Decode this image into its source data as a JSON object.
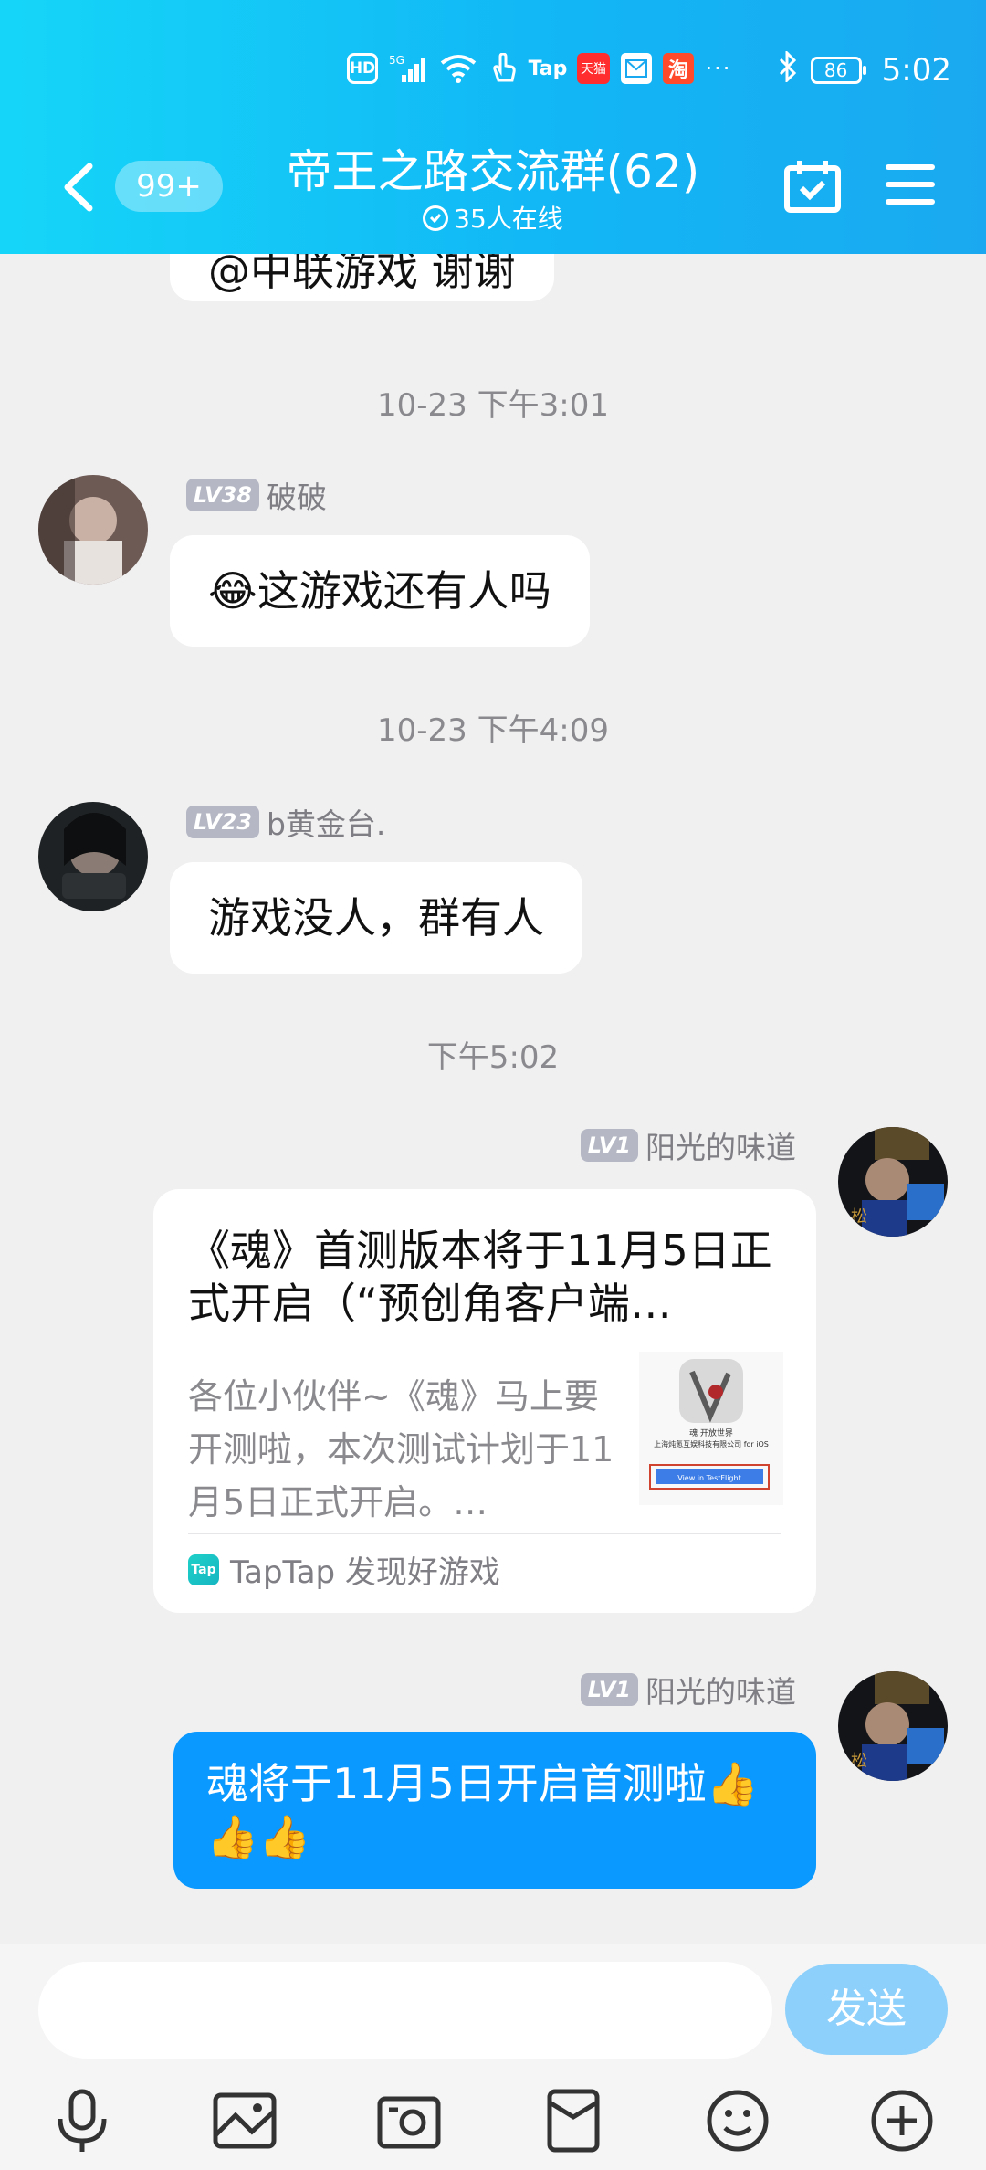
{
  "status_bar": {
    "hd": "HD",
    "network": "5G",
    "tap": "Tap",
    "tmall": "天猫",
    "taobao": "淘",
    "more": "···",
    "battery": "86",
    "time": "5:02"
  },
  "header": {
    "unread_badge": "99+",
    "title": "帝王之路交流群(62)",
    "online": "35人在线"
  },
  "messages": {
    "top_partial": "@中联游戏 谢谢",
    "ts1": "10-23 下午3:01",
    "m1": {
      "level": "LV38",
      "name": "破破",
      "text": "😂这游戏还有人吗"
    },
    "ts2": "10-23 下午4:09",
    "m2": {
      "level": "LV23",
      "name": "b黄金台.",
      "text": "游戏没人，群有人"
    },
    "ts3": "下午5:02",
    "m3": {
      "level": "LV1",
      "name": "阳光的味道",
      "card_title": "《魂》首测版本将于11月5日正式开启（“预创角客户端…",
      "card_desc": "各位小伙伴~《魂》马上要开测啦，本次测试计划于11月5日正式开启。…",
      "card_source": "TapTap 发现好游戏",
      "tap_logo": "Tap",
      "thumb_name": "魂 开放世界",
      "thumb_company": "上海炖氪互娱科技有限公司 for iOS",
      "thumb_button": "View in TestFlight"
    },
    "m4": {
      "level": "LV1",
      "name": "阳光的味道",
      "text": "魂将于11月5日开启首测啦👍👍👍"
    }
  },
  "input": {
    "value": "",
    "send_label": "发送"
  },
  "colors": {
    "header_gradient_start": "#15d6f8",
    "header_gradient_end": "#1aa9f0",
    "my_bubble": "#0a99ff",
    "send_button": "#8cd0fb"
  }
}
